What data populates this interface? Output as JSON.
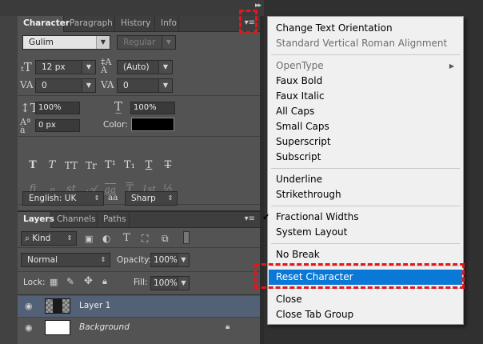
{
  "character_panel": {
    "tabs": [
      "Character",
      "Paragraph",
      "History",
      "Info"
    ],
    "font_family": "Gulim",
    "font_style": "Regular",
    "font_size": "12 px",
    "leading": "(Auto)",
    "kerning": "0",
    "tracking": "0",
    "vertical_scale": "100%",
    "horizontal_scale": "100%",
    "baseline_shift": "0 px",
    "color_label": "Color:",
    "text_color": "#000000",
    "type_style_buttons": [
      "T",
      "T",
      "TT",
      "Tr",
      "T¹",
      "T₁",
      "T",
      "T"
    ],
    "opentype_buttons": [
      "fi",
      "ℴ",
      "st",
      "𝒜",
      "aa",
      "T",
      "1st",
      "½"
    ],
    "language": "English: UK",
    "antialias_icon_label": "aa",
    "antialias": "Sharp"
  },
  "layers_panel": {
    "tabs": [
      "Layers",
      "Channels",
      "Paths"
    ],
    "filter_kind": "Kind",
    "blend_mode": "Normal",
    "opacity_label": "Opacity:",
    "opacity": "100%",
    "lock_label": "Lock:",
    "fill_label": "Fill:",
    "fill": "100%",
    "layers": [
      {
        "name": "Layer 1",
        "selected": true
      },
      {
        "name": "Background",
        "selected": false,
        "locked": true
      }
    ]
  },
  "flyout_menu": {
    "items": [
      {
        "label": "Change Text Orientation",
        "enabled": true
      },
      {
        "label": "Standard Vertical Roman Alignment",
        "enabled": false
      },
      {
        "separator": true
      },
      {
        "label": "OpenType",
        "enabled": false,
        "submenu": true
      },
      {
        "label": "Faux Bold",
        "enabled": true
      },
      {
        "label": "Faux Italic",
        "enabled": true
      },
      {
        "label": "All Caps",
        "enabled": true
      },
      {
        "label": "Small Caps",
        "enabled": true
      },
      {
        "label": "Superscript",
        "enabled": true
      },
      {
        "label": "Subscript",
        "enabled": true
      },
      {
        "separator": true
      },
      {
        "label": "Underline",
        "enabled": true
      },
      {
        "label": "Strikethrough",
        "enabled": true
      },
      {
        "separator": true
      },
      {
        "label": "Fractional Widths",
        "enabled": true,
        "checked": true
      },
      {
        "label": "System Layout",
        "enabled": true
      },
      {
        "separator": true
      },
      {
        "label": "No Break",
        "enabled": true
      },
      {
        "separator": true
      },
      {
        "label": "Reset Character",
        "enabled": true,
        "highlighted": true
      },
      {
        "separator": true
      },
      {
        "label": "Close",
        "enabled": true
      },
      {
        "label": "Close Tab Group",
        "enabled": true
      }
    ]
  },
  "colors": {
    "highlight": "#0A78D7",
    "annotation": "#E8141C",
    "panel_bg": "#535353",
    "selected_layer": "#536176"
  }
}
